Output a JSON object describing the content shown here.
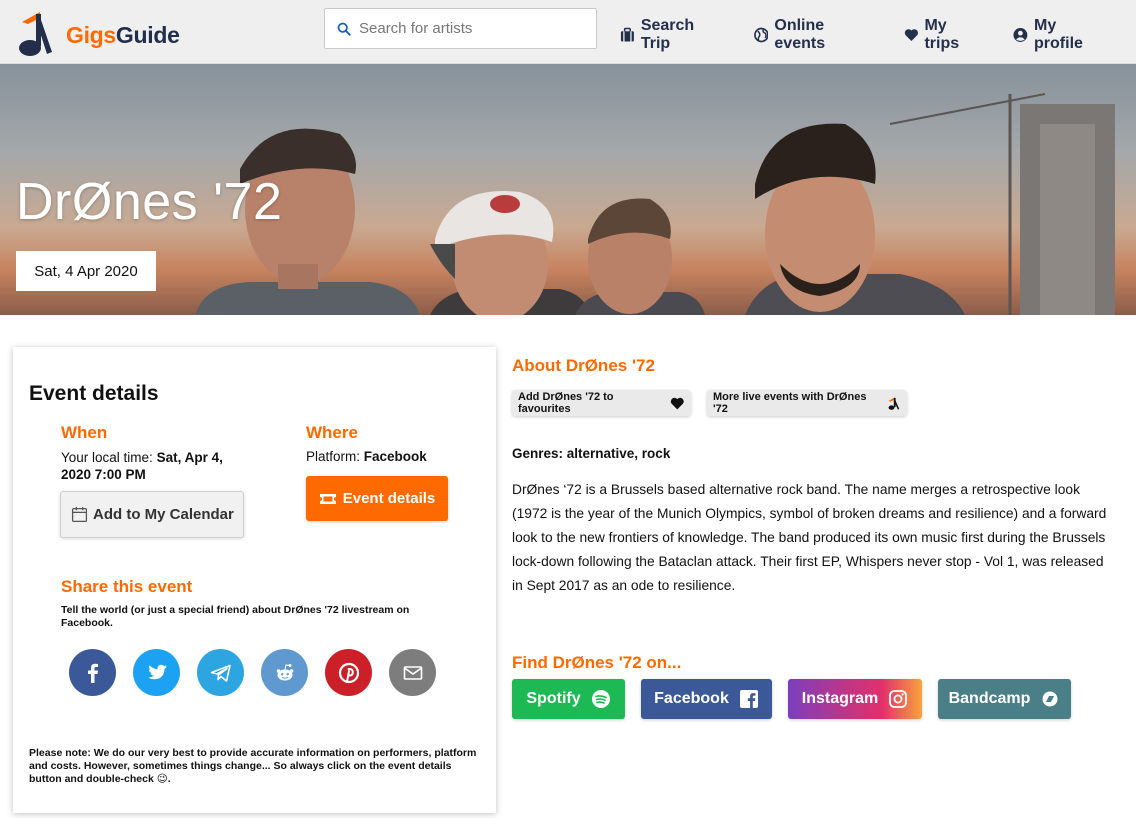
{
  "brand": {
    "name_part1": "Gigs",
    "name_part2": "Guide"
  },
  "search": {
    "placeholder": "Search for artists",
    "value": ""
  },
  "nav": [
    {
      "label": "Search Trip",
      "icon": "suitcase-icon"
    },
    {
      "label": "Online events",
      "icon": "globe-icon"
    },
    {
      "label": "My trips",
      "icon": "heart-icon"
    },
    {
      "label": "My profile",
      "icon": "user-circle-icon"
    }
  ],
  "hero": {
    "title": "DrØnes '72",
    "date": "Sat, 4 Apr 2020"
  },
  "event": {
    "heading": "Event details",
    "when_heading": "When",
    "local_time_label": "Your local time: ",
    "local_time_value": "Sat, Apr 4, 2020 7:00 PM",
    "calendar_button": "Add to My Calendar",
    "where_heading": "Where",
    "platform_label": "Platform: ",
    "platform_value": "Facebook",
    "details_button": "Event details",
    "share_heading": "Share this event",
    "share_text": "Tell the world (or just a special friend) about DrØnes '72 livestream on Facebook.",
    "share_icons": [
      {
        "name": "facebook-share",
        "color": "#3b5998"
      },
      {
        "name": "twitter-share",
        "color": "#1da1f2"
      },
      {
        "name": "telegram-share",
        "color": "#2ca5e0"
      },
      {
        "name": "reddit-share",
        "color": "#5f99cf"
      },
      {
        "name": "pinterest-share",
        "color": "#cb2027"
      },
      {
        "name": "email-share",
        "color": "#7d7d7d"
      }
    ],
    "note": "Please note: We do our very best to provide accurate information on performers, platform and costs. However, sometimes things change... So always click on the event details button and double-check 😉."
  },
  "about": {
    "heading": "About DrØnes '72",
    "fav_chip": "Add DrØnes '72 to favourites",
    "more_chip": "More live events with DrØnes '72",
    "genres": "Genres: alternative, rock",
    "bio": "DrØnes ‘72 is a Brussels based alternative rock band. The name merges a retrospective look (1972 is the year of the Munich Olympics, symbol of broken dreams and resilience) and a forward look to the new frontiers of knowledge. The band produced its own music first during the Brussels lock-down following the Bataclan attack. Their first EP, Whispers never stop - Vol 1, was released in Sept 2017 as an ode to resilience.",
    "find_heading": "Find DrØnes '72 on...",
    "links": [
      {
        "label": "Spotify",
        "color": "#1db954",
        "icon": "spotify-icon"
      },
      {
        "label": "Facebook",
        "color": "#3b5998",
        "icon": "facebook-icon"
      },
      {
        "label": "Instagram",
        "color": "#c13584",
        "icon": "instagram-icon"
      },
      {
        "label": "Bandcamp",
        "color": "#4a7f87",
        "icon": "bandcamp-icon"
      }
    ]
  },
  "colors": {
    "accent": "#ff6a00",
    "navy": "#232f4b"
  }
}
